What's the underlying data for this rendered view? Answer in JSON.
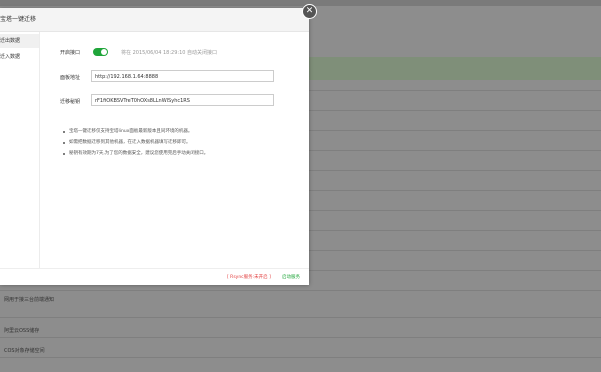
{
  "modal": {
    "title": "宝塔一键迁移",
    "close_symbol": "✕",
    "sidebar": [
      {
        "label": "迁出数据"
      },
      {
        "label": "迁入数据"
      }
    ],
    "api": {
      "label": "开启接口",
      "enabled": true,
      "hint": "将在 2015/06/04 18:29:10 自动关闭接口"
    },
    "panel_url": {
      "label": "面板地址",
      "value": "http://192.168.1.64:8888"
    },
    "token": {
      "label": "迁移秘钥",
      "value": "rF1fiOKBSVTreT0hOXs8LLnWlSyhc1RS"
    },
    "tips": [
      "宝塔一键迁移仅支持宝塔linux面板最新版本且同环境的机器。",
      "如需把数据迁移到其他机器，在迁入数据机器填写迁移即可。",
      "秘钥有效期为7天,为了您的数据安全，建议您使用完后手动关闭接口。"
    ],
    "footer": {
      "status": "[ Rsync服务:未开启 ]",
      "link": "启动服务"
    }
  },
  "background": {
    "rows": [
      {
        "label": "网用于接三台前端通知"
      },
      {
        "label": "阿里云OSS储存"
      },
      {
        "label": "COS对象存储空间"
      }
    ]
  },
  "colors": {
    "accent_green": "#20a53a",
    "status_red": "#e23c3c"
  }
}
